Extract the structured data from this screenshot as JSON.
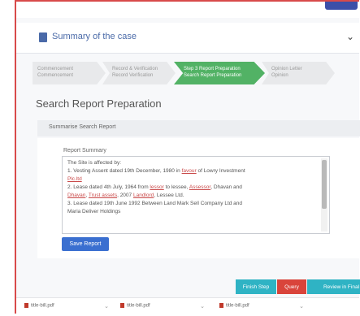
{
  "header": {
    "title": "Summary of the case"
  },
  "steps": [
    {
      "line1": "Commencement",
      "line2": "Commencement"
    },
    {
      "line1": "Record & Verification",
      "line2": "Record Verification"
    },
    {
      "line1": "Step 3 Report Preparation",
      "line2": "Search Report Preparation"
    },
    {
      "line1": "Opinion Letter",
      "line2": "Opinion"
    }
  ],
  "page": {
    "heading": "Search Report Preparation",
    "subheading": "Summarise Search Report"
  },
  "summary": {
    "label": "Report Summary",
    "lines": [
      [
        "The Site is affected by:"
      ],
      [
        "1. Vesting Assent dated 19th December, 1980 in ",
        "favour",
        " of Lowry Investment"
      ],
      [
        "",
        "Plc.ltd",
        ""
      ],
      [
        "2. Lease dated 4th July, 1964 from ",
        "lessor",
        " to lessee, ",
        "Assessor",
        ", Dhavan and"
      ],
      [
        "",
        "Dhavan",
        ", ",
        "Trust assets",
        ", 2007 ",
        "Landlord",
        ", Lessee Ltd."
      ],
      [
        "3. Lease dated 19th June 1992 Between Land Mark Sell Company Ltd and"
      ],
      [
        "Maria Deliver Holdings"
      ]
    ],
    "save_label": "Save Report"
  },
  "actions": {
    "finish": "Finish Step",
    "query": "Query",
    "review": "Review in Final"
  },
  "footer": {
    "items": [
      "title-bill.pdf",
      "title-bill.pdf",
      "title-bill.pdf"
    ]
  }
}
